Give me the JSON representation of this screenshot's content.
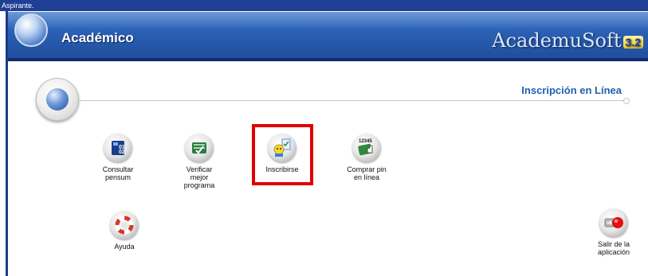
{
  "window": {
    "title": "Aspirante."
  },
  "banner": {
    "module_title": "Académico",
    "brand_name": "AcademuSoft",
    "brand_version": "3.2"
  },
  "section": {
    "title": "Inscripción en Línea"
  },
  "apps": [
    {
      "label": "Consultar\npensum",
      "icon": "pensum-icon"
    },
    {
      "label": "Verificar\nmejor\nprograma",
      "icon": "checklist-icon"
    },
    {
      "label": "Inscribirse",
      "icon": "enroll-icon"
    },
    {
      "label": "Comprar pin\nen línea",
      "icon": "buy-pin-icon",
      "icon_text": "12345"
    },
    {
      "label": "Ayuda",
      "icon": "help-lifebuoy-icon"
    },
    {
      "label": "Salir de la\naplicación",
      "icon": "exit-icon"
    }
  ],
  "colors": {
    "banner": "#2a5fb3",
    "accent_text": "#1f5fb0",
    "highlight": "#e00000"
  }
}
